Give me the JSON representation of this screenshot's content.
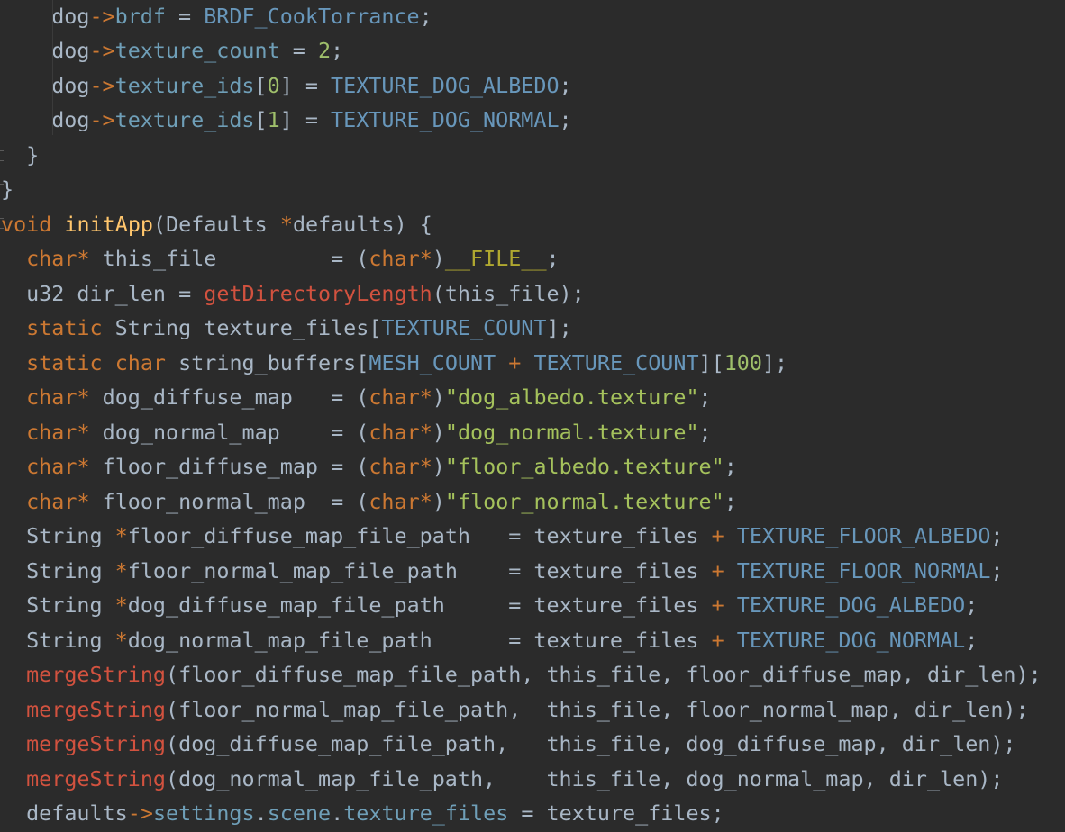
{
  "editor": {
    "lines": [
      {
        "indent": 4,
        "tokens": [
          {
            "t": "dog",
            "c": "plain"
          },
          {
            "t": "->",
            "c": "op"
          },
          {
            "t": "brdf",
            "c": "member"
          },
          {
            "t": " = ",
            "c": "plain"
          },
          {
            "t": "BRDF_CookTorrance",
            "c": "const"
          },
          {
            "t": ";",
            "c": "plain"
          }
        ]
      },
      {
        "indent": 4,
        "tokens": [
          {
            "t": "dog",
            "c": "plain"
          },
          {
            "t": "->",
            "c": "op"
          },
          {
            "t": "texture_count",
            "c": "member"
          },
          {
            "t": " = ",
            "c": "plain"
          },
          {
            "t": "2",
            "c": "num"
          },
          {
            "t": ";",
            "c": "plain"
          }
        ]
      },
      {
        "indent": 4,
        "tokens": [
          {
            "t": "dog",
            "c": "plain"
          },
          {
            "t": "->",
            "c": "op"
          },
          {
            "t": "texture_ids",
            "c": "member"
          },
          {
            "t": "[",
            "c": "plain"
          },
          {
            "t": "0",
            "c": "num"
          },
          {
            "t": "] = ",
            "c": "plain"
          },
          {
            "t": "TEXTURE_DOG_ALBEDO",
            "c": "const"
          },
          {
            "t": ";",
            "c": "plain"
          }
        ]
      },
      {
        "indent": 4,
        "tokens": [
          {
            "t": "dog",
            "c": "plain"
          },
          {
            "t": "->",
            "c": "op"
          },
          {
            "t": "texture_ids",
            "c": "member"
          },
          {
            "t": "[",
            "c": "plain"
          },
          {
            "t": "1",
            "c": "num"
          },
          {
            "t": "] = ",
            "c": "plain"
          },
          {
            "t": "TEXTURE_DOG_NORMAL",
            "c": "const"
          },
          {
            "t": ";",
            "c": "plain"
          }
        ]
      },
      {
        "indent": 2,
        "tokens": [
          {
            "t": "}",
            "c": "plain"
          }
        ]
      },
      {
        "indent": 0,
        "tokens": [
          {
            "t": "}",
            "c": "plain"
          }
        ]
      },
      {
        "indent": 0,
        "tokens": [
          {
            "t": "void",
            "c": "kw"
          },
          {
            "t": " ",
            "c": "plain"
          },
          {
            "t": "initApp",
            "c": "fn"
          },
          {
            "t": "(Defaults ",
            "c": "plain"
          },
          {
            "t": "*",
            "c": "op"
          },
          {
            "t": "defaults) {",
            "c": "plain"
          }
        ]
      },
      {
        "indent": 2,
        "tokens": [
          {
            "t": "char",
            "c": "kw"
          },
          {
            "t": "*",
            "c": "op"
          },
          {
            "t": " this_file         = (",
            "c": "plain"
          },
          {
            "t": "char",
            "c": "kw"
          },
          {
            "t": "*",
            "c": "op"
          },
          {
            "t": ")",
            "c": "plain"
          },
          {
            "t": "__FILE__",
            "c": "macro"
          },
          {
            "t": ";",
            "c": "plain"
          }
        ]
      },
      {
        "indent": 2,
        "tokens": [
          {
            "t": "u32 dir_len = ",
            "c": "plain"
          },
          {
            "t": "getDirectoryLength",
            "c": "call"
          },
          {
            "t": "(this_file);",
            "c": "plain"
          }
        ]
      },
      {
        "indent": 2,
        "tokens": [
          {
            "t": "static",
            "c": "kw"
          },
          {
            "t": " String texture_files[",
            "c": "plain"
          },
          {
            "t": "TEXTURE_COUNT",
            "c": "const"
          },
          {
            "t": "];",
            "c": "plain"
          }
        ]
      },
      {
        "indent": 2,
        "tokens": [
          {
            "t": "static",
            "c": "kw"
          },
          {
            "t": " ",
            "c": "plain"
          },
          {
            "t": "char",
            "c": "kw"
          },
          {
            "t": " string_buffers[",
            "c": "plain"
          },
          {
            "t": "MESH_COUNT",
            "c": "const"
          },
          {
            "t": " ",
            "c": "plain"
          },
          {
            "t": "+",
            "c": "op"
          },
          {
            "t": " ",
            "c": "plain"
          },
          {
            "t": "TEXTURE_COUNT",
            "c": "const"
          },
          {
            "t": "][",
            "c": "plain"
          },
          {
            "t": "100",
            "c": "num"
          },
          {
            "t": "];",
            "c": "plain"
          }
        ]
      },
      {
        "indent": 2,
        "tokens": [
          {
            "t": "char",
            "c": "kw"
          },
          {
            "t": "*",
            "c": "op"
          },
          {
            "t": " dog_diffuse_map   = (",
            "c": "plain"
          },
          {
            "t": "char",
            "c": "kw"
          },
          {
            "t": "*",
            "c": "op"
          },
          {
            "t": ")",
            "c": "plain"
          },
          {
            "t": "\"dog_albedo.texture\"",
            "c": "str2"
          },
          {
            "t": ";",
            "c": "plain"
          }
        ]
      },
      {
        "indent": 2,
        "tokens": [
          {
            "t": "char",
            "c": "kw"
          },
          {
            "t": "*",
            "c": "op"
          },
          {
            "t": " dog_normal_map    = (",
            "c": "plain"
          },
          {
            "t": "char",
            "c": "kw"
          },
          {
            "t": "*",
            "c": "op"
          },
          {
            "t": ")",
            "c": "plain"
          },
          {
            "t": "\"dog_normal.texture\"",
            "c": "str2"
          },
          {
            "t": ";",
            "c": "plain"
          }
        ]
      },
      {
        "indent": 2,
        "tokens": [
          {
            "t": "char",
            "c": "kw"
          },
          {
            "t": "*",
            "c": "op"
          },
          {
            "t": " floor_diffuse_map = (",
            "c": "plain"
          },
          {
            "t": "char",
            "c": "kw"
          },
          {
            "t": "*",
            "c": "op"
          },
          {
            "t": ")",
            "c": "plain"
          },
          {
            "t": "\"floor_albedo.texture\"",
            "c": "str2"
          },
          {
            "t": ";",
            "c": "plain"
          }
        ]
      },
      {
        "indent": 2,
        "tokens": [
          {
            "t": "char",
            "c": "kw"
          },
          {
            "t": "*",
            "c": "op"
          },
          {
            "t": " floor_normal_map  = (",
            "c": "plain"
          },
          {
            "t": "char",
            "c": "kw"
          },
          {
            "t": "*",
            "c": "op"
          },
          {
            "t": ")",
            "c": "plain"
          },
          {
            "t": "\"floor_normal.texture\"",
            "c": "str2"
          },
          {
            "t": ";",
            "c": "plain"
          }
        ]
      },
      {
        "indent": 2,
        "tokens": [
          {
            "t": "String ",
            "c": "plain"
          },
          {
            "t": "*",
            "c": "op"
          },
          {
            "t": "floor_diffuse_map_file_path   = texture_files ",
            "c": "plain"
          },
          {
            "t": "+",
            "c": "op"
          },
          {
            "t": " ",
            "c": "plain"
          },
          {
            "t": "TEXTURE_FLOOR_ALBEDO",
            "c": "const"
          },
          {
            "t": ";",
            "c": "plain"
          }
        ]
      },
      {
        "indent": 2,
        "tokens": [
          {
            "t": "String ",
            "c": "plain"
          },
          {
            "t": "*",
            "c": "op"
          },
          {
            "t": "floor_normal_map_file_path    = texture_files ",
            "c": "plain"
          },
          {
            "t": "+",
            "c": "op"
          },
          {
            "t": " ",
            "c": "plain"
          },
          {
            "t": "TEXTURE_FLOOR_NORMAL",
            "c": "const"
          },
          {
            "t": ";",
            "c": "plain"
          }
        ]
      },
      {
        "indent": 2,
        "tokens": [
          {
            "t": "String ",
            "c": "plain"
          },
          {
            "t": "*",
            "c": "op"
          },
          {
            "t": "dog_diffuse_map_file_path     = texture_files ",
            "c": "plain"
          },
          {
            "t": "+",
            "c": "op"
          },
          {
            "t": " ",
            "c": "plain"
          },
          {
            "t": "TEXTURE_DOG_ALBEDO",
            "c": "const"
          },
          {
            "t": ";",
            "c": "plain"
          }
        ]
      },
      {
        "indent": 2,
        "tokens": [
          {
            "t": "String ",
            "c": "plain"
          },
          {
            "t": "*",
            "c": "op"
          },
          {
            "t": "dog_normal_map_file_path      = texture_files ",
            "c": "plain"
          },
          {
            "t": "+",
            "c": "op"
          },
          {
            "t": " ",
            "c": "plain"
          },
          {
            "t": "TEXTURE_DOG_NORMAL",
            "c": "const"
          },
          {
            "t": ";",
            "c": "plain"
          }
        ]
      },
      {
        "indent": 2,
        "tokens": [
          {
            "t": "mergeString",
            "c": "call"
          },
          {
            "t": "(floor_diffuse_map_file_path, this_file, floor_diffuse_map, dir_len);",
            "c": "plain"
          }
        ]
      },
      {
        "indent": 2,
        "tokens": [
          {
            "t": "mergeString",
            "c": "call"
          },
          {
            "t": "(floor_normal_map_file_path,  this_file, floor_normal_map, dir_len);",
            "c": "plain"
          }
        ]
      },
      {
        "indent": 2,
        "tokens": [
          {
            "t": "mergeString",
            "c": "call"
          },
          {
            "t": "(dog_diffuse_map_file_path,   this_file, dog_diffuse_map, dir_len);",
            "c": "plain"
          }
        ]
      },
      {
        "indent": 2,
        "tokens": [
          {
            "t": "mergeString",
            "c": "call"
          },
          {
            "t": "(dog_normal_map_file_path,    this_file, dog_normal_map, dir_len);",
            "c": "plain"
          }
        ]
      },
      {
        "indent": 2,
        "tokens": [
          {
            "t": "defaults",
            "c": "plain"
          },
          {
            "t": "->",
            "c": "op"
          },
          {
            "t": "settings",
            "c": "member"
          },
          {
            "t": ".",
            "c": "plain"
          },
          {
            "t": "scene",
            "c": "member"
          },
          {
            "t": ".",
            "c": "plain"
          },
          {
            "t": "texture_files",
            "c": "member"
          },
          {
            "t": " = texture_files;",
            "c": "plain"
          }
        ]
      }
    ]
  },
  "colors": {
    "background": "#2b2b2b",
    "plain": "#a9b7c6",
    "keyword": "#cc7832",
    "function_decl": "#ffc66d",
    "function_call": "#d2523f",
    "constant": "#6897bb",
    "number": "#9fbf6b",
    "string": "#a5c25c",
    "member": "#6f9fb8",
    "macro": "#b0a830"
  }
}
